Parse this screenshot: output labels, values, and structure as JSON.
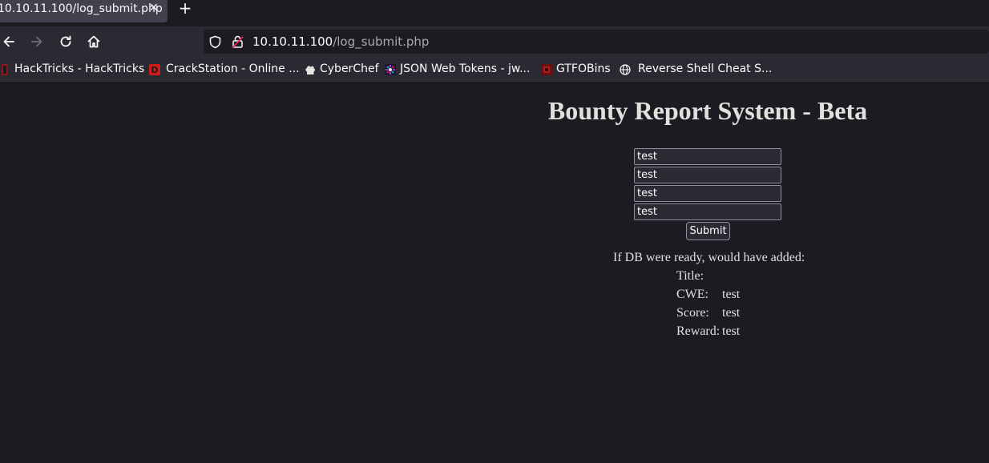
{
  "browser": {
    "tab": {
      "title": "10.10.11.100/log_submit.php",
      "close_glyph": "✕"
    },
    "newtab_glyph": "+",
    "url": {
      "host": "10.10.11.100",
      "path": "/log_submit.php"
    },
    "bookmarks": [
      {
        "label": "HackTricks - HackTricks",
        "icon": "hacktricks-icon"
      },
      {
        "label": "CrackStation - Online ...",
        "icon": "crackstation-icon"
      },
      {
        "label": "CyberChef",
        "icon": "cyberchef-icon"
      },
      {
        "label": "JSON Web Tokens - jw...",
        "icon": "jwt-icon"
      },
      {
        "label": "GTFOBins",
        "icon": "gtfobins-icon"
      },
      {
        "label": "Reverse Shell Cheat S...",
        "icon": "globe-icon"
      }
    ]
  },
  "page": {
    "title": "Bounty Report System - Beta",
    "fields": [
      {
        "value": "test"
      },
      {
        "value": "test"
      },
      {
        "value": "test"
      },
      {
        "value": "test"
      }
    ],
    "submit_label": "Submit",
    "result": {
      "heading": "If DB were ready, would have added:",
      "rows": [
        {
          "label": "Title:",
          "value": ""
        },
        {
          "label": "CWE:",
          "value": "test"
        },
        {
          "label": "Score:",
          "value": "test"
        },
        {
          "label": "Reward:",
          "value": "test"
        }
      ]
    }
  },
  "colors": {
    "page_bg": "#1c1b22",
    "toolbar_bg": "#2b2a33",
    "tab_active": "#42414d",
    "text": "#fbfbfe"
  }
}
